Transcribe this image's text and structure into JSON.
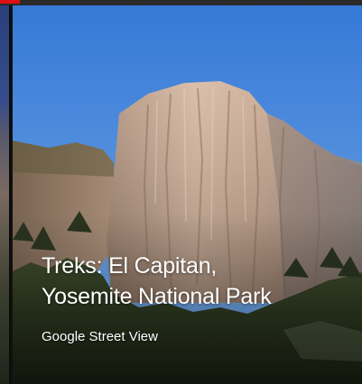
{
  "card": {
    "title_line1": "Treks: El Capitan,",
    "title_line2": "Yosemite National Park",
    "subtitle": "Google Street View"
  },
  "colors": {
    "sky_top": "#3a7fd8",
    "sky_bottom": "#6fa6e6",
    "rock": "#c9a98f",
    "forest": "#2f3a22",
    "title_text": "#ffffff",
    "top_bar_indicator": "#d11111"
  }
}
